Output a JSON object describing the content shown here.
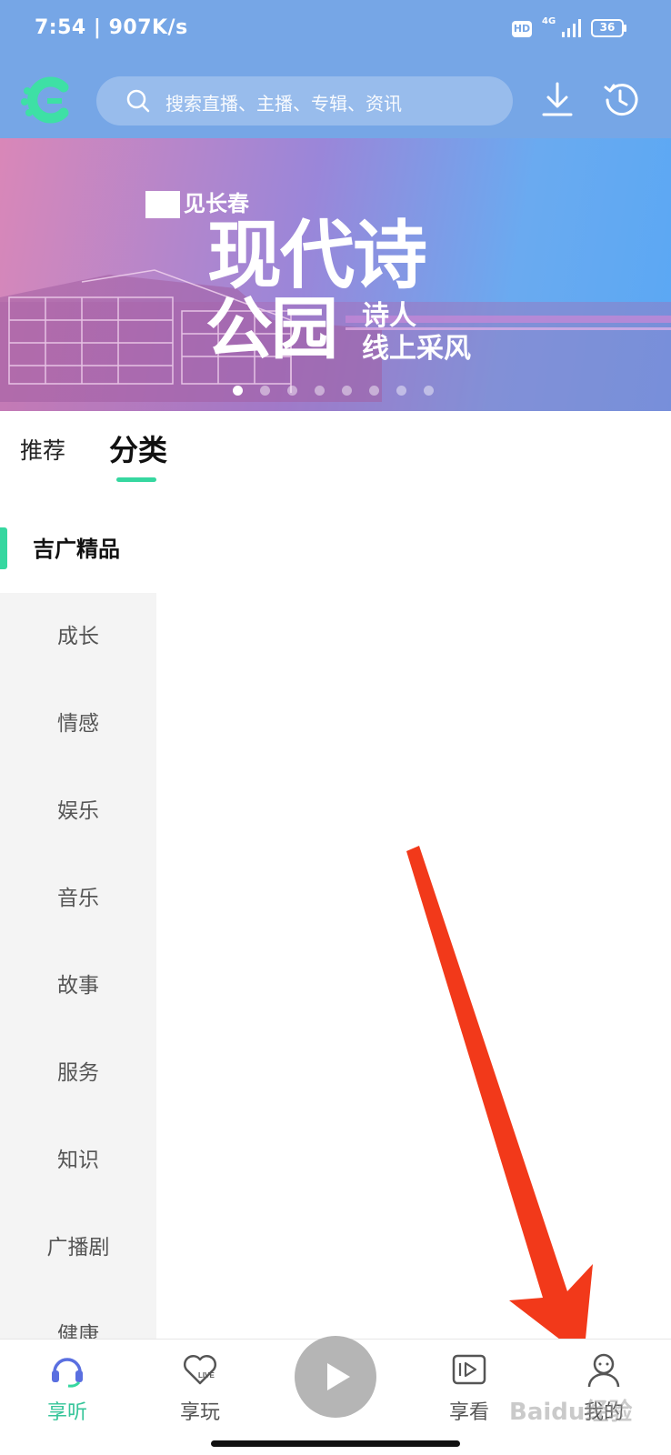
{
  "status_bar": {
    "time": "7:54 | 907K/s",
    "hd_badge": "HD",
    "network": "4G",
    "battery": "36"
  },
  "header": {
    "search_placeholder": "搜索直播、主播、专辑、资讯",
    "icons": [
      "app-logo",
      "search-icon",
      "download-icon",
      "history-icon"
    ]
  },
  "banner": {
    "tag": "见长春",
    "title_line1": "现代诗",
    "title_line2": "公园",
    "subtitle_line1": "诗人",
    "subtitle_line2": "线上采风",
    "slide_count": 8,
    "active_slide": 1
  },
  "tabs": {
    "recommend": "推荐",
    "category": "分类",
    "active": "分类"
  },
  "sidebar": {
    "active_item": "吉广精品",
    "items": [
      "成长",
      "情感",
      "娱乐",
      "音乐",
      "故事",
      "服务",
      "知识",
      "广播剧",
      "健康"
    ]
  },
  "bottom_nav": {
    "items": [
      {
        "label": "享听",
        "icon": "headphones-icon",
        "active": true
      },
      {
        "label": "享玩",
        "icon": "heart-live-icon",
        "active": false
      },
      {
        "label": "享看",
        "icon": "video-play-icon",
        "active": false
      },
      {
        "label": "我的",
        "icon": "user-icon",
        "active": false
      }
    ],
    "play_icon": "play-icon"
  },
  "overlay": {
    "watermark": "Baidu经验",
    "arrow_color": "#f2391a"
  },
  "colors": {
    "header_bg": "#76a6e6",
    "accent": "#36d7a0",
    "sidebar_bg": "#f4f4f4"
  }
}
